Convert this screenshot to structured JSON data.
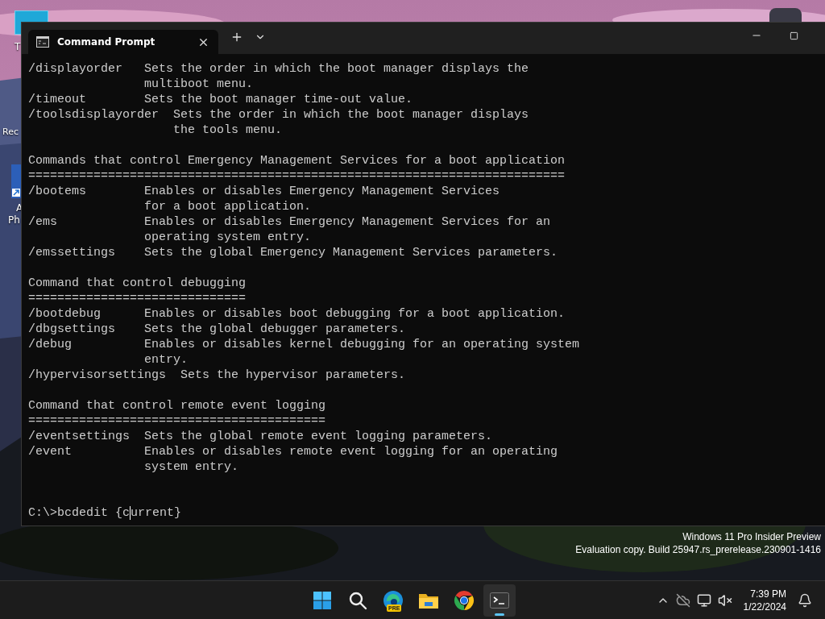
{
  "desktop_icons": [
    {
      "kind": "tile",
      "label_lines": [
        "T"
      ]
    },
    {
      "kind": "hidden",
      "label_lines": [
        "Rec"
      ]
    },
    {
      "kind": "shortcut",
      "label_lines": [
        "A",
        "Ph"
      ]
    }
  ],
  "window": {
    "tab": {
      "title": "Command Prompt",
      "selected": true
    },
    "terminal": {
      "sections": [
        {
          "lines": [
            "/displayorder   Sets the order in which the boot manager displays the",
            "                multiboot menu.",
            "/timeout        Sets the boot manager time-out value.",
            "/toolsdisplayorder  Sets the order in which the boot manager displays",
            "                    the tools menu."
          ]
        },
        {
          "lines": [
            "Commands that control Emergency Management Services for a boot application",
            "==========================================================================",
            "/bootems        Enables or disables Emergency Management Services",
            "                for a boot application.",
            "/ems            Enables or disables Emergency Management Services for an",
            "                operating system entry.",
            "/emssettings    Sets the global Emergency Management Services parameters."
          ]
        },
        {
          "lines": [
            "Command that control debugging",
            "==============================",
            "/bootdebug      Enables or disables boot debugging for a boot application.",
            "/dbgsettings    Sets the global debugger parameters.",
            "/debug          Enables or disables kernel debugging for an operating system",
            "                entry.",
            "/hypervisorsettings  Sets the hypervisor parameters."
          ]
        },
        {
          "lines": [
            "Command that control remote event logging",
            "=========================================",
            "/eventsettings  Sets the global remote event logging parameters.",
            "/event          Enables or disables remote event logging for an operating",
            "                system entry."
          ]
        }
      ],
      "prompt": {
        "text_before_cursor": "C:\\>bcdedit {c",
        "text_after_cursor": "urrent}"
      }
    }
  },
  "watermark": {
    "edition": "Windows 11 Pro Insider Preview",
    "build": "Evaluation copy. Build 25947.rs_prerelease.230901-1416"
  },
  "taskbar": {
    "apps": [
      {
        "kind": "start",
        "selected": false
      },
      {
        "kind": "search",
        "selected": false
      },
      {
        "kind": "edge",
        "badge": "PRE",
        "selected": false
      },
      {
        "kind": "explorer",
        "selected": false
      },
      {
        "kind": "chrome",
        "selected": false
      },
      {
        "kind": "terminal",
        "selected": true
      }
    ],
    "tray": {
      "time": "7:39 PM",
      "date": "1/22/2024"
    }
  }
}
